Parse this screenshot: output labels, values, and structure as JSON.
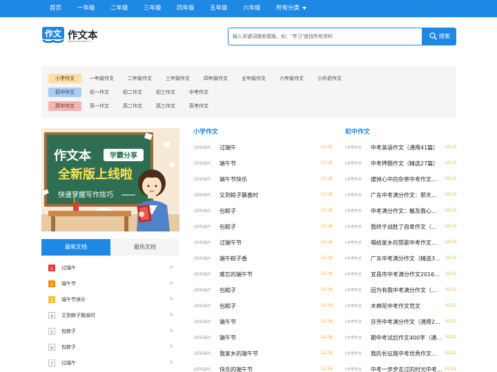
{
  "nav": {
    "items": [
      "首页",
      "一年级",
      "二年级",
      "三年级",
      "四年级",
      "五年级",
      "六年级"
    ],
    "all_label": "所有分类"
  },
  "logo": {
    "badge": "作文",
    "name": "作文本",
    "url": "www.zuowenben.cn"
  },
  "search": {
    "placeholder": "输入关键词搜索模版，如：\"学习\"查找所有资料",
    "button_label": "搜索"
  },
  "categories": [
    {
      "tag": "小学作文",
      "tag_color": "#ffe0a3",
      "links": [
        "一年级作文",
        "二年级作文",
        "三年级作文",
        "四年级作文",
        "五年级作文",
        "六年级作文",
        "小升初作文"
      ]
    },
    {
      "tag": "初中作文",
      "tag_color": "#a9cdf5",
      "links": [
        "初一作文",
        "初二作文",
        "初三作文",
        "中考作文"
      ]
    },
    {
      "tag": "高中作文",
      "tag_color": "#f7b2b2",
      "links": [
        "高一作文",
        "高二作文",
        "高三作文",
        "高考作文"
      ]
    }
  ],
  "banner": {
    "title": "作文本",
    "badge": "学霸分享",
    "headline": "全新版上线啦",
    "subline": "快速掌握写作技巧"
  },
  "tabs": {
    "latest": "最新文档",
    "hot": "最热文档"
  },
  "ranking": [
    {
      "num": "1",
      "title": "过端午",
      "count": "0"
    },
    {
      "num": "2",
      "title": "端午节",
      "count": "0"
    },
    {
      "num": "3",
      "title": "端午节快乐",
      "count": "0"
    },
    {
      "num": "4",
      "title": "又到粽子飘香时",
      "count": "0"
    },
    {
      "num": "5",
      "title": "包粽子",
      "count": "0"
    },
    {
      "num": "6",
      "title": "包粽子",
      "count": "0"
    },
    {
      "num": "7",
      "title": "过端午",
      "count": "0"
    }
  ],
  "primary": {
    "heading": "小学作文",
    "articles": [
      {
        "tag": "[四年级作",
        "title": "过端午",
        "date": "12-18"
      },
      {
        "tag": "[四年级作",
        "title": "端午节",
        "date": "12-18"
      },
      {
        "tag": "[四年级作",
        "title": "端午节快乐",
        "date": "12-18"
      },
      {
        "tag": "[四年级作",
        "title": "又到粽子飘香时",
        "date": "12-18"
      },
      {
        "tag": "[四年级作",
        "title": "包粽子",
        "date": "12-18"
      },
      {
        "tag": "[四年级作",
        "title": "包粽子",
        "date": "12-18"
      },
      {
        "tag": "[四年级作",
        "title": "过端午节",
        "date": "12-18"
      },
      {
        "tag": "[四年级作",
        "title": "端午粽子香",
        "date": "12-18"
      },
      {
        "tag": "[四年级作",
        "title": "难忘的端午节",
        "date": "12-18"
      },
      {
        "tag": "[四年级作",
        "title": "包粽子",
        "date": "12-18"
      },
      {
        "tag": "[四年级作",
        "title": "包粽子",
        "date": "12-18"
      },
      {
        "tag": "[四年级作",
        "title": "端午节",
        "date": "12-18"
      },
      {
        "tag": "[四年级作",
        "title": "端午节",
        "date": "12-18"
      },
      {
        "tag": "[四年级作",
        "title": "我家乡的端午节",
        "date": "12-18"
      },
      {
        "tag": "[四年级作",
        "title": "快乐的端午节",
        "date": "12-18"
      }
    ]
  },
  "middle": {
    "heading": "初中作文",
    "articles": [
      {
        "tag": "[中考作文",
        "title": "中考英语作文（通用41篇）",
        "date": "10-23"
      },
      {
        "tag": "[中考作文",
        "title": "中考押题作文（精选27篇）",
        "date": "10-23"
      },
      {
        "tag": "[中考作文",
        "title": "拔掉心中的杂草中考作文...",
        "date": "10-23"
      },
      {
        "tag": "[中考作文",
        "title": "广东中考满分作文：那天...",
        "date": "10-23"
      },
      {
        "tag": "[中考作文",
        "title": "中考满分作文：触及我心...",
        "date": "10-23"
      },
      {
        "tag": "[中考作文",
        "title": "我终于战胜了自卑作文（...",
        "date": "10-23"
      },
      {
        "tag": "[中考作文",
        "title": "唱给家乡的赞歌中考作文...",
        "date": "10-23"
      },
      {
        "tag": "[中考作文",
        "title": "广东中考满分作文（精选3...",
        "date": "10-23"
      },
      {
        "tag": "[中考作文",
        "title": "宜昌市中考满分作文2016...",
        "date": "10-22"
      },
      {
        "tag": "[中考作文",
        "title": "因为有我中考满分作文（...",
        "date": "10-22"
      },
      {
        "tag": "[中考作文",
        "title": "木棉花中考作文范文",
        "date": "10-22"
      },
      {
        "tag": "[中考作文",
        "title": "芬芳中考满分作文（通用2...",
        "date": "10-22"
      },
      {
        "tag": "[中考作文",
        "title": "期中考试后作文400字（通...",
        "date": "10-22"
      },
      {
        "tag": "[中考作文",
        "title": "我的长征路中考优秀作文...",
        "date": "10-22"
      },
      {
        "tag": "[中考作文",
        "title": "中考一步步走过的时光中考...",
        "date": "10-22"
      }
    ]
  }
}
